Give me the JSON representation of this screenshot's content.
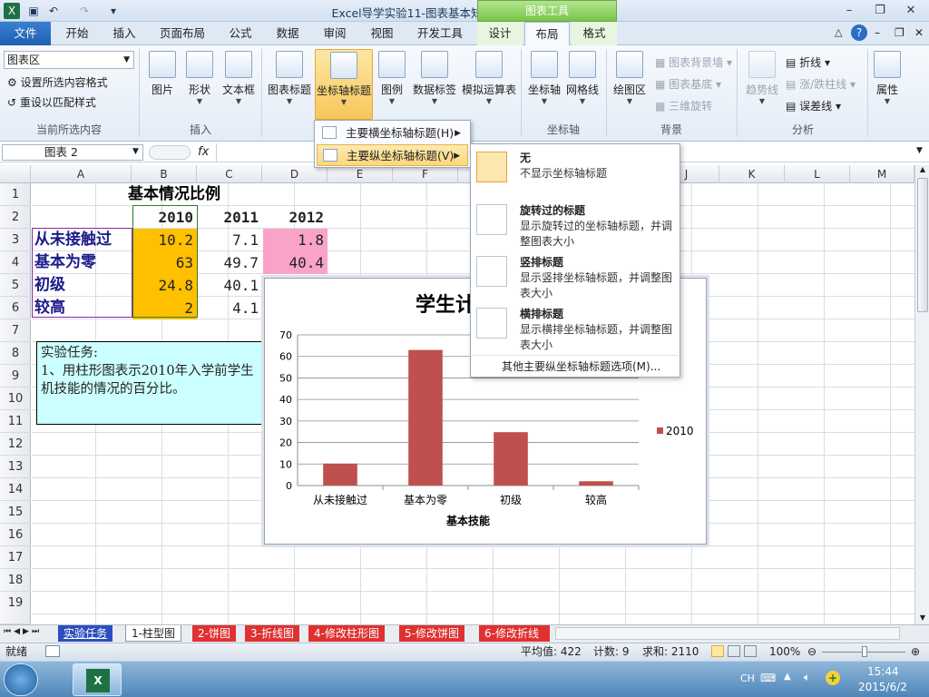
{
  "window": {
    "title": "Excel导学实验11-图表基本知识1  -  Microsoft Excel",
    "contextual_group": "图表工具"
  },
  "tabs": [
    "文件",
    "开始",
    "插入",
    "页面布局",
    "公式",
    "数据",
    "审阅",
    "视图",
    "开发工具",
    "设计",
    "布局",
    "格式"
  ],
  "active_tab": "布局",
  "ribbon": {
    "selection_box_value": "图表区",
    "format_selection": "设置所选内容格式",
    "reset_style": "重设以匹配样式",
    "group_current": "当前所选内容",
    "insert_buttons": [
      "图片",
      "形状",
      "文本框"
    ],
    "group_insert": "插入",
    "label_buttons": [
      "图表标题",
      "坐标轴标题",
      "图例",
      "数据标签",
      "模拟运算表"
    ],
    "axes_buttons": [
      "坐标轴",
      "网格线"
    ],
    "group_axes": "坐标轴",
    "plot_area": "绘图区",
    "bg_items": [
      "图表背景墙",
      "图表基底",
      "三维旋转"
    ],
    "group_background": "背景",
    "trendline": "趋势线",
    "analysis_items": [
      "折线",
      "涨/跌柱线",
      "误差线"
    ],
    "group_analysis": "分析",
    "properties": "属性"
  },
  "formula_bar": {
    "name_box": "图表 2",
    "fx": "fx"
  },
  "columns": [
    "A",
    "B",
    "C",
    "D",
    "E",
    "F",
    "G",
    "H",
    "I",
    "J",
    "K",
    "L",
    "M"
  ],
  "rows": [
    "1",
    "2",
    "3",
    "4",
    "5",
    "6",
    "7",
    "8",
    "9",
    "10",
    "11",
    "12",
    "13",
    "14",
    "15",
    "16",
    "17",
    "18",
    "19"
  ],
  "sheet": {
    "title": "基本情况比例",
    "years": [
      "2010",
      "2011",
      "2012"
    ],
    "data_rows": [
      {
        "label": "从未接触过",
        "v2010": "10.2",
        "v2011": "7.1",
        "v2012": "1.8"
      },
      {
        "label": "基本为零",
        "v2010": "63",
        "v2011": "49.7",
        "v2012": "40.4"
      },
      {
        "label": "初级",
        "v2010": "24.8",
        "v2011": "40.1",
        "v2012": ""
      },
      {
        "label": "较高",
        "v2010": "2",
        "v2011": "4.1",
        "v2012": ""
      }
    ],
    "task_title": "实验任务:",
    "task_text": "1、用柱形图表示2010年入学前学生",
    "task_text2": "机技能的情况的百分比。"
  },
  "chart_data": {
    "type": "bar",
    "title": "学生计算机技",
    "categories": [
      "从未接触过",
      "基本为零",
      "初级",
      "较高"
    ],
    "series": [
      {
        "name": "2010",
        "values": [
          10.2,
          63,
          24.8,
          2
        ],
        "color": "#c0504d"
      }
    ],
    "xlabel": "基本技能",
    "ylabel": "",
    "ylim": [
      0,
      70
    ],
    "yticks": [
      "0",
      "10",
      "20",
      "30",
      "40",
      "50",
      "60",
      "70"
    ],
    "grid": true,
    "legend": "right"
  },
  "menu_axis": {
    "items": [
      "主要横坐标轴标题(H)",
      "主要纵坐标轴标题(V)"
    ],
    "active_index": 1
  },
  "submenu": {
    "options": [
      {
        "title": "无",
        "desc": "不显示坐标轴标题"
      },
      {
        "title": "旋转过的标题",
        "desc": "显示旋转过的坐标轴标题，并调整图表大小"
      },
      {
        "title": "竖排标题",
        "desc": "显示竖排坐标轴标题，并调整图表大小"
      },
      {
        "title": "横排标题",
        "desc": "显示横排坐标轴标题，并调整图表大小"
      }
    ],
    "more": "其他主要纵坐标轴标题选项(M)..."
  },
  "sheet_tabs": [
    "实验任务",
    "1-柱型图",
    "2-饼图",
    "3-折线图",
    "4-修改柱形图",
    "5-修改饼图",
    "6-修改折线"
  ],
  "active_sheet": "1-柱型图",
  "status": {
    "mode": "就绪",
    "average": "平均值: 422",
    "count": "计数: 9",
    "sum": "求和: 2110",
    "zoom": "100%"
  },
  "taskbar": {
    "lang": "CH",
    "time": "15:44",
    "date": "2015/6/2"
  }
}
